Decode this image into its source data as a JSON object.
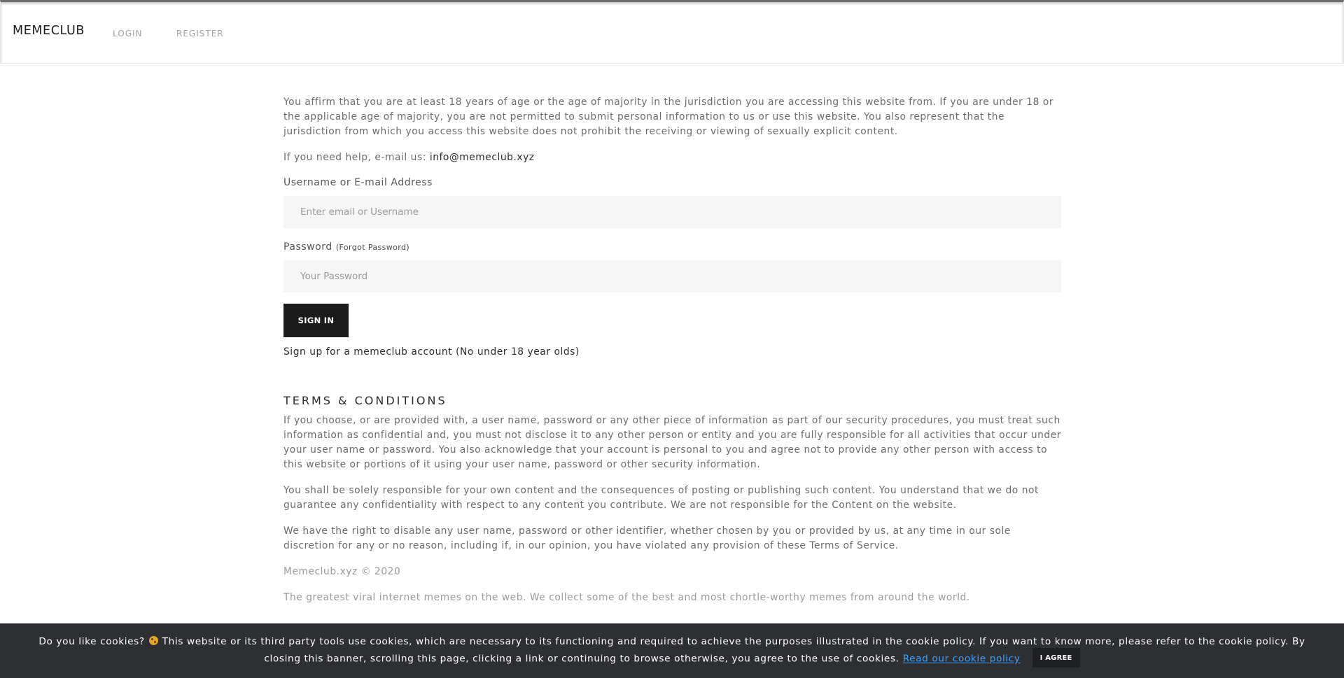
{
  "header": {
    "brand": "MEMECLUB",
    "nav": {
      "login": "LOGIN",
      "register": "REGISTER"
    }
  },
  "login": {
    "age_notice": "You affirm that you are at least 18 years of age or the age of majority in the jurisdiction you are accessing this website from. If you are under 18 or the applicable age of majority, you are not permitted to submit personal information to us or use this website. You also represent that the jurisdiction from which you access this website does not prohibit the receiving or viewing of sexually explicit content.",
    "help_prefix": "If you need help, e-mail us: ",
    "help_email": "info@memeclub.xyz",
    "username_label": "Username or E-mail Address",
    "username_placeholder": "Enter email or Username",
    "password_label": "Password",
    "forgot_password": "(Forgot Password)",
    "password_placeholder": "Your Password",
    "signin_label": "SIGN IN",
    "signup_text": "Sign up for a memeclub account (No under 18 year olds)"
  },
  "terms": {
    "heading": "TERMS & CONDITIONS",
    "paragraphs": [
      "If you choose, or are provided with, a user name, password or any other piece of information as part of our security procedures, you must treat such information as confidential and, you must not disclose it to any other person or entity and you are fully responsible for all activities that occur under your user name or password. You also acknowledge that your account is personal to you and agree not to provide any other person with access to this website or portions of it using your user name, password or other security information.",
      "You shall be solely responsible for your own content and the consequences of posting or publishing such content. You understand that we do not guarantee any confidentiality with respect to any content you contribute. We are not responsible for the Content on the website.",
      "We have the right to disable any user name, password or other identifier, whether chosen by you or provided by us, at any time in our sole discretion for any or no reason, including if, in our opinion, you have violated any provision of these Terms of Service."
    ],
    "copyright": "Memeclub.xyz © 2020",
    "tagline": "The greatest viral internet memes on the web. We collect some of the best and most chortle-worthy memes from around the world."
  },
  "cookie": {
    "text_before_emoji": "Do you like cookies?",
    "emoji_icon": "cookie-emoji-icon",
    "text_after_emoji": "This website or its third party tools use cookies, which are necessary to its functioning and required to achieve the purposes illustrated in the cookie policy. If you want to know more, please refer to the cookie policy. By closing this banner, scrolling this page, clicking a link or continuing to browse otherwise, you agree to the use of cookies.",
    "policy_link": "Read our cookie policy",
    "agree_label": "I AGREE"
  },
  "colors": {
    "button_bg": "#1b1b1b",
    "input_bg": "#f6f6f7",
    "cookie_bg": "#2d2f33",
    "cookie_link": "#3fa2ff"
  }
}
